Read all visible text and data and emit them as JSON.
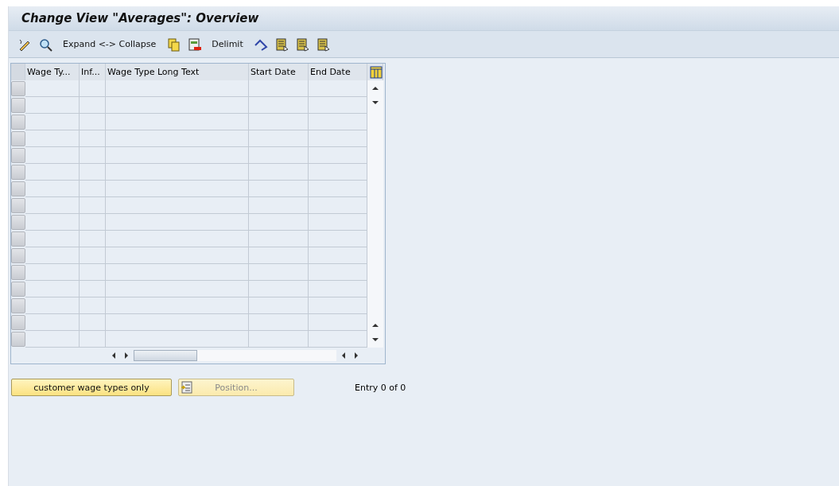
{
  "window": {
    "title": "Change View \"Averages\": Overview"
  },
  "toolbar": [
    {
      "kind": "icon"
    },
    {
      "kind": "icon"
    },
    {
      "kind": "text",
      "label": "Expand <-> Collapse"
    },
    {
      "kind": "icon"
    },
    {
      "kind": "icon"
    },
    {
      "kind": "text",
      "label": "Delimit"
    },
    {
      "kind": "icon"
    },
    {
      "kind": "icon"
    },
    {
      "kind": "icon"
    },
    {
      "kind": "icon"
    }
  ],
  "table": {
    "columns": [
      "Wage Ty...",
      "Inf...",
      "Wage Type Long Text",
      "Start Date",
      "End Date"
    ]
  },
  "buttons": [
    {
      "label": "customer wage types only",
      "disabled": false
    },
    {
      "label": "Position...",
      "disabled": true
    }
  ],
  "entry_info": "Entry 0 of 0"
}
